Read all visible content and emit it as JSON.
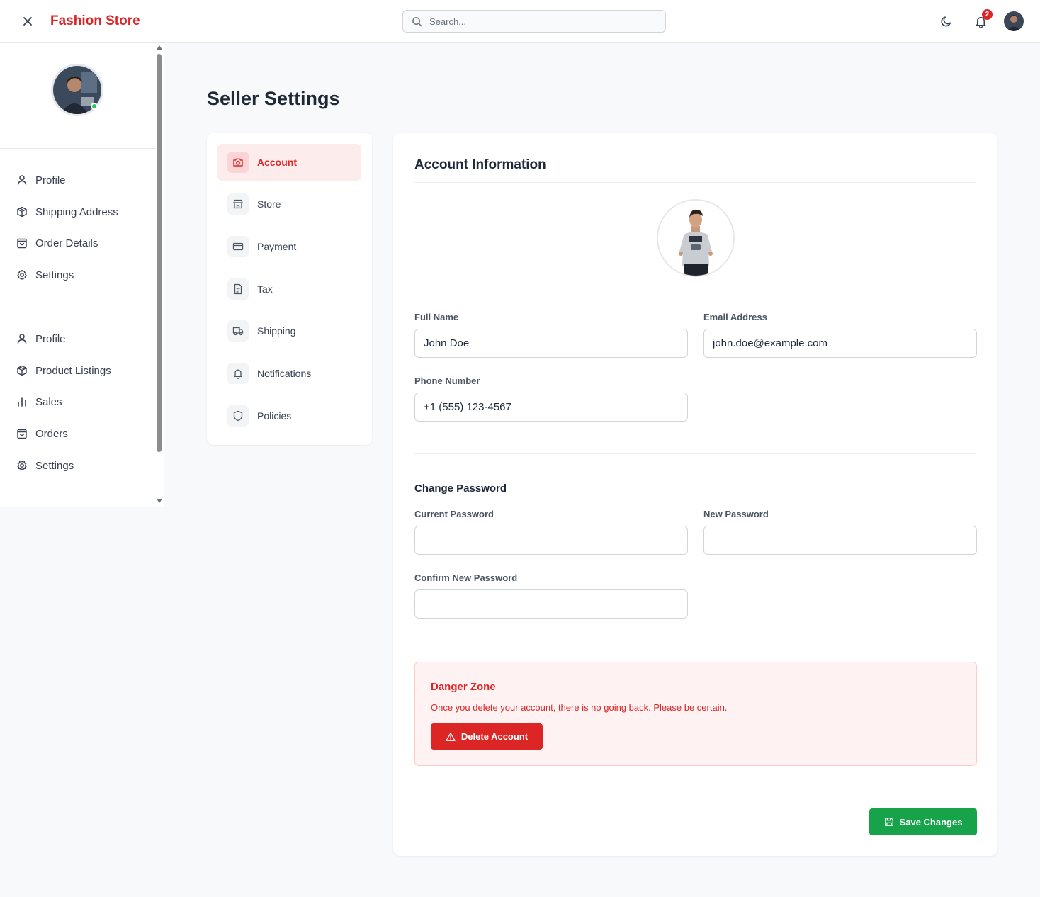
{
  "header": {
    "brand": "Fashion Store",
    "search_placeholder": "Search...",
    "notification_count": "2",
    "icons": [
      "close-icon",
      "search-icon",
      "moon-icon",
      "bell-icon"
    ]
  },
  "sidebar": {
    "items": [
      {
        "label": "Profile",
        "icon": "user-icon"
      },
      {
        "label": "Shipping Address",
        "icon": "package-icon"
      },
      {
        "label": "Order Details",
        "icon": "bag-icon"
      },
      {
        "label": "Settings",
        "icon": "gear-icon"
      },
      {
        "label": "Profile",
        "icon": "user-icon"
      },
      {
        "label": "Product Listings",
        "icon": "package-icon"
      },
      {
        "label": "Sales",
        "icon": "bar-chart-icon"
      },
      {
        "label": "Orders",
        "icon": "bag-icon"
      },
      {
        "label": "Settings",
        "icon": "gear-icon"
      }
    ]
  },
  "page": {
    "title": "Seller Settings"
  },
  "settings_nav": {
    "items": [
      {
        "label": "Account",
        "icon": "camera-icon",
        "active": true
      },
      {
        "label": "Store",
        "icon": "store-icon",
        "active": false
      },
      {
        "label": "Payment",
        "icon": "credit-card-icon",
        "active": false
      },
      {
        "label": "Tax",
        "icon": "document-icon",
        "active": false
      },
      {
        "label": "Shipping",
        "icon": "truck-icon",
        "active": false
      },
      {
        "label": "Notifications",
        "icon": "bell-icon",
        "active": false
      },
      {
        "label": "Policies",
        "icon": "shield-icon",
        "active": false
      }
    ]
  },
  "account": {
    "title": "Account Information",
    "full_name_label": "Full Name",
    "full_name_value": "John Doe",
    "email_label": "Email Address",
    "email_value": "john.doe@example.com",
    "phone_label": "Phone Number",
    "phone_value": "+1 (555) 123-4567"
  },
  "password": {
    "title": "Change Password",
    "current_label": "Current Password",
    "new_label": "New Password",
    "confirm_label": "Confirm New Password"
  },
  "danger": {
    "title": "Danger Zone",
    "text": "Once you delete your account, there is no going back. Please be certain.",
    "button": "Delete Account"
  },
  "actions": {
    "save": "Save Changes"
  },
  "colors": {
    "brand": "#dc2626",
    "danger": "#dc2626",
    "save": "#16a34a"
  }
}
